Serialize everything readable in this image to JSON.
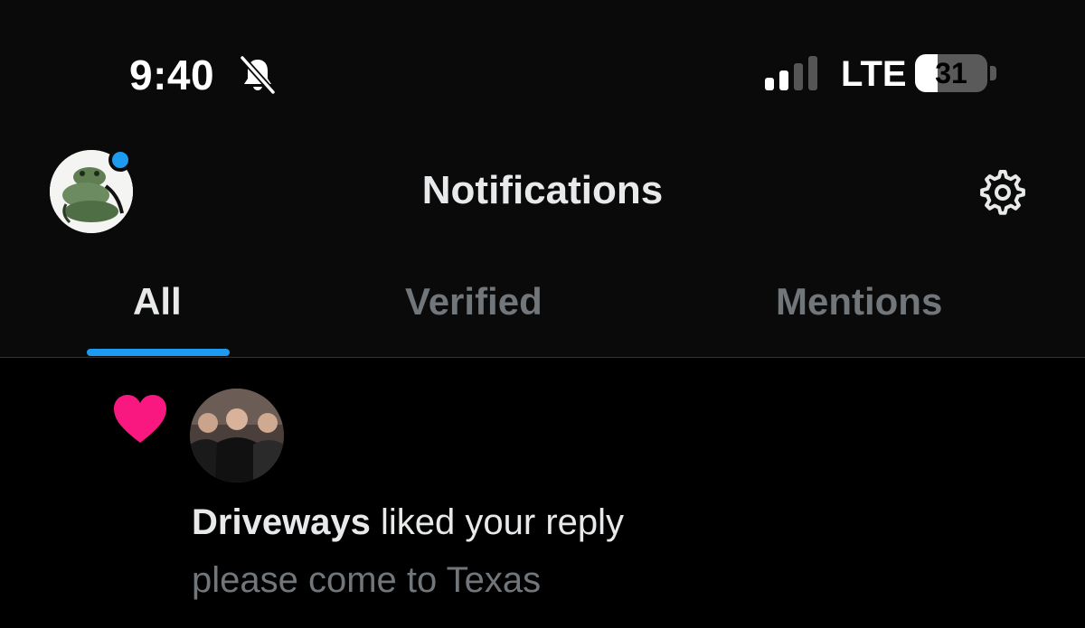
{
  "status_bar": {
    "time": "9:40",
    "network": "LTE",
    "battery_level": "31",
    "battery_fraction": 0.31,
    "icons": [
      "bell-slash-icon",
      "signal-icon",
      "battery-icon"
    ]
  },
  "header": {
    "title": "Notifications",
    "icons": [
      "profile-avatar",
      "gear-icon"
    ]
  },
  "tabs": [
    {
      "label": "All",
      "active": true
    },
    {
      "label": "Verified",
      "active": false
    },
    {
      "label": "Mentions",
      "active": false
    }
  ],
  "colors": {
    "accent": "#1d9bf0",
    "like": "#f91880",
    "background": "#000000",
    "text_primary": "#e7e9ea",
    "text_secondary": "#71767b"
  },
  "notifications": [
    {
      "type_icon": "heart-icon",
      "user": "Driveways",
      "action": " liked your reply",
      "quote": "please come to Texas"
    }
  ]
}
